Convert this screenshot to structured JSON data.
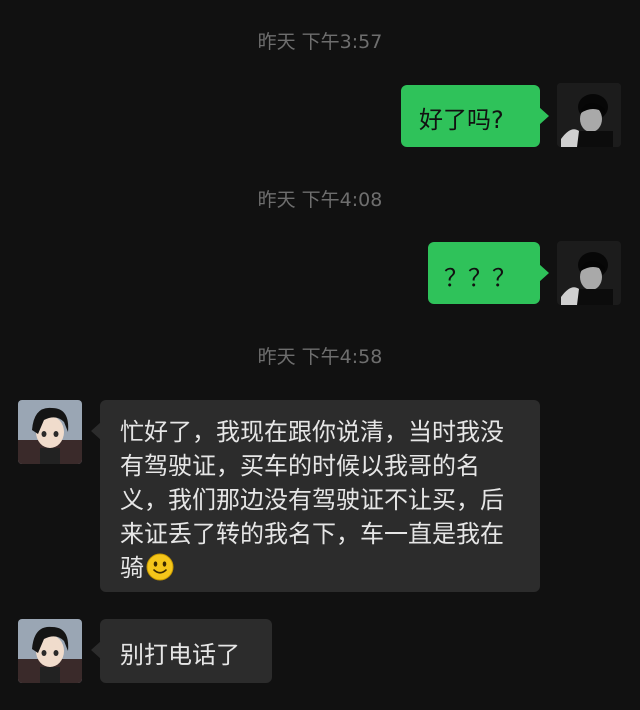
{
  "chat": {
    "timestamps": [
      "昨天 下午3:57",
      "昨天 下午4:08",
      "昨天 下午4:58"
    ],
    "messages": [
      {
        "direction": "out",
        "text": "好了吗?"
      },
      {
        "direction": "out",
        "text": "？？？"
      },
      {
        "direction": "in",
        "text": "忙好了，我现在跟你说清，当时我没有驾驶证，买车的时候以我哥的名义，我们那边没有驾驶证不让买，后来证丢了转的我名下，车一直是我在骑",
        "emoji": "smile-emoji"
      },
      {
        "direction": "in",
        "text": "别打电话了"
      }
    ]
  },
  "colors": {
    "background": "#111111",
    "outgoing_bubble": "#2fc25a",
    "incoming_bubble": "#2c2c2c",
    "timestamp": "#6e6e6e"
  },
  "icons": {
    "outgoing_avatar": "user-avatar-photo",
    "incoming_avatar": "anime-avatar"
  }
}
